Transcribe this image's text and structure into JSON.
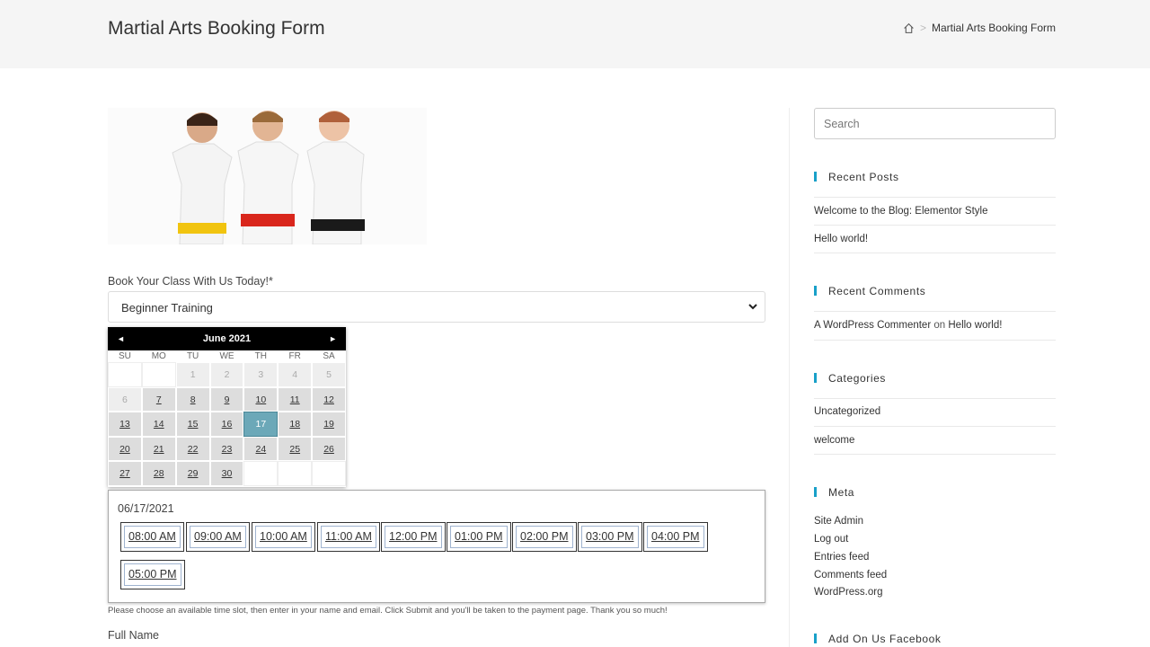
{
  "header": {
    "title": "Martial Arts Booking Form",
    "breadcrumb_current": "Martial Arts Booking Form",
    "breadcrumb_sep": ">"
  },
  "form": {
    "label": "Book Your Class With Us Today!*",
    "select_value": "Beginner Training",
    "calendar": {
      "month": "June 2021",
      "prev": "◄",
      "next": "►",
      "dow": [
        "SU",
        "MO",
        "TU",
        "WE",
        "TH",
        "FR",
        "SA"
      ],
      "days": [
        {
          "d": "",
          "s": "empty"
        },
        {
          "d": "",
          "s": "empty"
        },
        {
          "d": "1",
          "s": "dis"
        },
        {
          "d": "2",
          "s": "dis"
        },
        {
          "d": "3",
          "s": "dis"
        },
        {
          "d": "4",
          "s": "dis"
        },
        {
          "d": "5",
          "s": "dis"
        },
        {
          "d": "6",
          "s": "dis"
        },
        {
          "d": "7",
          "s": "avail"
        },
        {
          "d": "8",
          "s": "avail"
        },
        {
          "d": "9",
          "s": "avail"
        },
        {
          "d": "10",
          "s": "avail"
        },
        {
          "d": "11",
          "s": "avail"
        },
        {
          "d": "12",
          "s": "avail"
        },
        {
          "d": "13",
          "s": "avail"
        },
        {
          "d": "14",
          "s": "avail"
        },
        {
          "d": "15",
          "s": "avail"
        },
        {
          "d": "16",
          "s": "avail"
        },
        {
          "d": "17",
          "s": "sel"
        },
        {
          "d": "18",
          "s": "avail"
        },
        {
          "d": "19",
          "s": "avail"
        },
        {
          "d": "20",
          "s": "avail"
        },
        {
          "d": "21",
          "s": "avail"
        },
        {
          "d": "22",
          "s": "avail"
        },
        {
          "d": "23",
          "s": "avail"
        },
        {
          "d": "24",
          "s": "avail"
        },
        {
          "d": "25",
          "s": "avail"
        },
        {
          "d": "26",
          "s": "avail"
        },
        {
          "d": "27",
          "s": "avail"
        },
        {
          "d": "28",
          "s": "avail"
        },
        {
          "d": "29",
          "s": "avail"
        },
        {
          "d": "30",
          "s": "avail"
        },
        {
          "d": "",
          "s": "empty"
        },
        {
          "d": "",
          "s": "empty"
        },
        {
          "d": "",
          "s": "empty"
        }
      ]
    },
    "slots_date": "06/17/2021",
    "slots": [
      "08:00 AM",
      "09:00 AM",
      "10:00 AM",
      "11:00 AM",
      "12:00 PM",
      "01:00 PM",
      "02:00 PM",
      "03:00 PM",
      "04:00 PM",
      "05:00 PM"
    ],
    "note": "Please choose an available time slot, then enter in your name and email. Click Submit and you'll be taken to the payment page. Thank you so much!",
    "full_name_label": "Full Name"
  },
  "sidebar": {
    "search_placeholder": "Search",
    "recent_posts_title": "Recent Posts",
    "recent_posts": [
      "Welcome to the Blog: Elementor Style",
      "Hello world!"
    ],
    "recent_comments_title": "Recent Comments",
    "comment_author": "A WordPress Commenter",
    "comment_on": "on",
    "comment_post": "Hello world!",
    "categories_title": "Categories",
    "categories": [
      "Uncategorized",
      "welcome"
    ],
    "meta_title": "Meta",
    "meta_links": [
      "Site Admin",
      "Log out",
      "Entries feed",
      "Comments feed",
      "WordPress.org"
    ],
    "facebook_title": "Add On Us Facebook"
  },
  "colors": {
    "accent": "#19a0c8",
    "selected_day": "#6ca8b8",
    "calendar_header": "#000000"
  }
}
